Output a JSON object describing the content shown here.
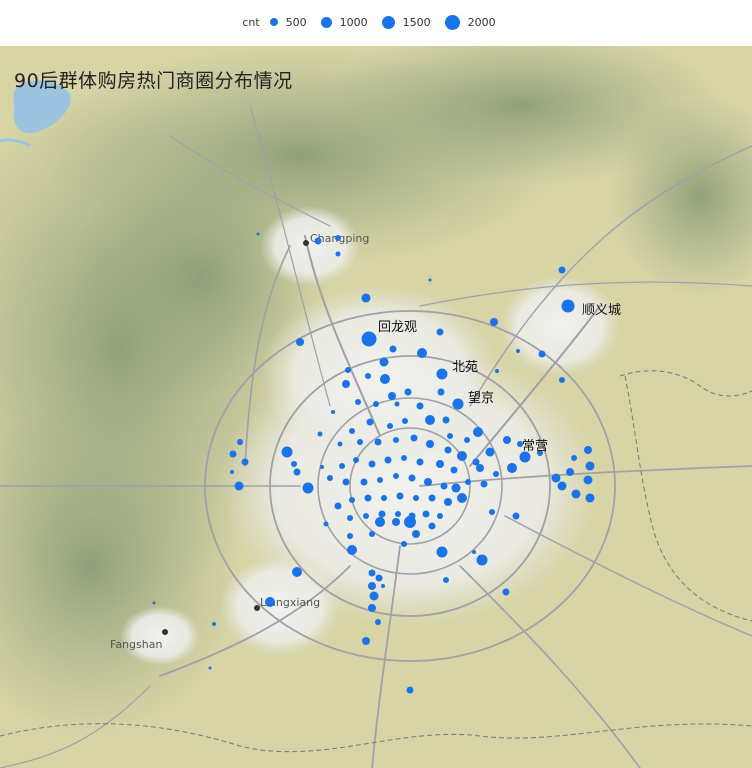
{
  "legend": {
    "title": "cnt",
    "items": [
      {
        "label": "500",
        "value": 500
      },
      {
        "label": "1000",
        "value": 1000
      },
      {
        "label": "1500",
        "value": 1500
      },
      {
        "label": "2000",
        "value": 2000
      }
    ]
  },
  "map": {
    "title": "90后群体购房热门商圈分布情况",
    "base_places": [
      "Changping",
      "Liangxiang",
      "Fangshan"
    ],
    "hotspot_labels": [
      "回龙观",
      "北苑",
      "望京",
      "常营",
      "顺义城"
    ]
  },
  "colors": {
    "bubble": "#1a73e8",
    "terrain": "#d9d6a8",
    "mountain": "#9aa880",
    "urban": "#eeeeee",
    "road": "#a0a0a8",
    "water": "#9cc3e0",
    "boundary": "#7a7a78"
  }
}
